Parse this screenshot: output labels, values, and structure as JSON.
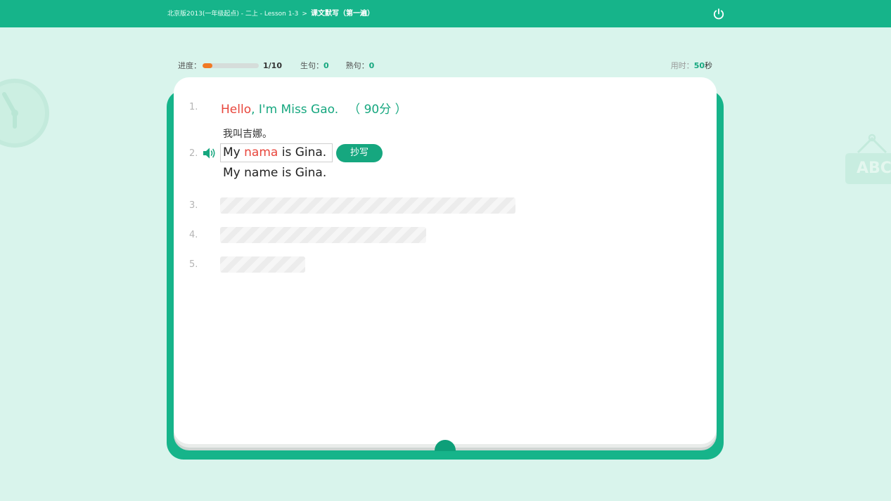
{
  "header": {
    "crumb_1": "北京版2013(一年级起点) - 二上 - Lesson 1-3",
    "separator": ">",
    "current": "课文默写（第一遍）"
  },
  "stats": {
    "progress_label": "进度：",
    "progress_fraction": 0.1,
    "progress_text": "1/10",
    "new_label": "生句：",
    "new_value": "0",
    "familiar_label": "熟句：",
    "familiar_value": "0"
  },
  "timer": {
    "label": "用时：",
    "value": "50",
    "unit": "秒"
  },
  "decor": {
    "abc_text": "ABC"
  },
  "sentences": [
    {
      "number": "1.",
      "parts": [
        "Hello",
        ", I'm Miss Gao."
      ],
      "score": "（ 90分 ）"
    },
    {
      "number": "2.",
      "hint": "我叫吉娜。",
      "answer": {
        "before": "My ",
        "error": "nama",
        "after": " is Gina."
      },
      "copy_label": "抄写",
      "correct": "My name is Gina."
    },
    {
      "number": "3."
    },
    {
      "number": "4."
    },
    {
      "number": "5."
    }
  ],
  "colors": {
    "brand": "#16b48a",
    "error": "#e8463c",
    "progress": "#f07a25"
  }
}
